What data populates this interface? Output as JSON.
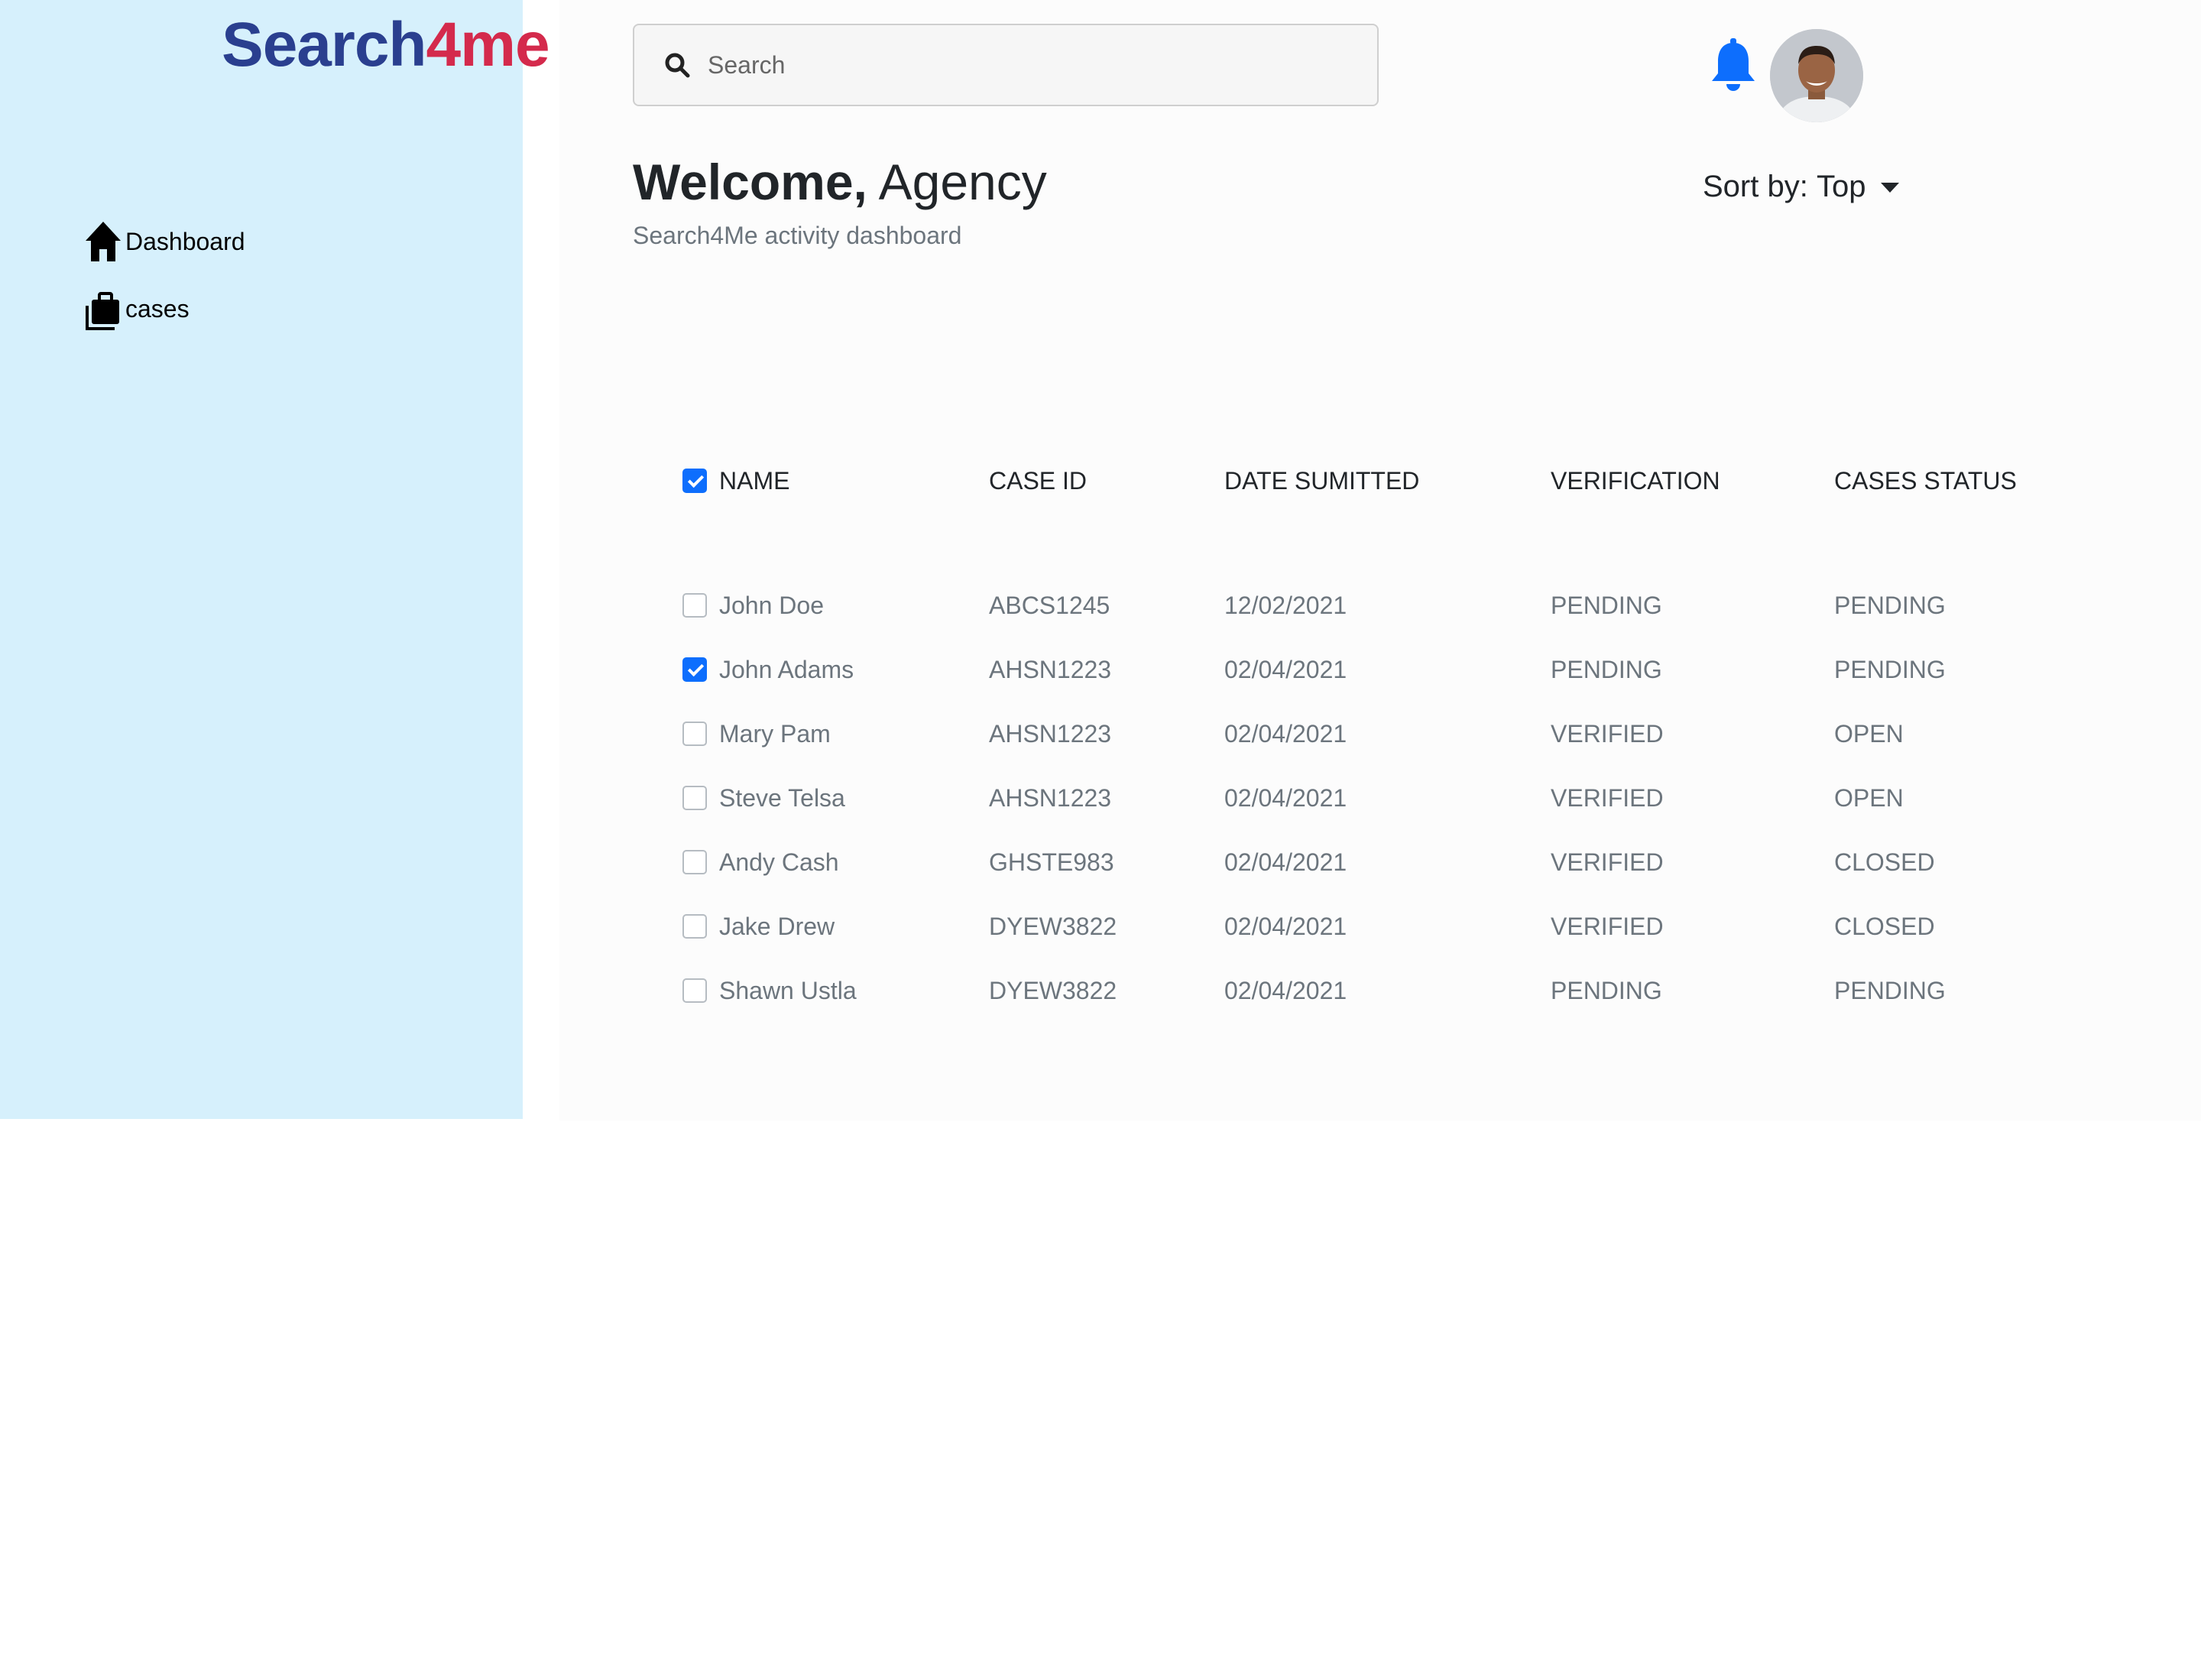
{
  "brand": {
    "part1": "Search",
    "part2": "4me",
    "color_blue": "#2a3f8f",
    "color_red": "#d42a4c"
  },
  "sidebar": {
    "background": "#d6f0fc",
    "items": [
      {
        "label": "Dashboard",
        "icon": "home-icon"
      },
      {
        "label": "cases",
        "icon": "briefcase-icon"
      }
    ]
  },
  "header": {
    "search": {
      "placeholder": "Search",
      "value": ""
    },
    "notification_icon": "bell-icon",
    "accent_color": "#0d6efd"
  },
  "main": {
    "welcome_bold": "Welcome,",
    "welcome_name": "Agency",
    "subtitle": "Search4Me activity dashboard",
    "sort_label": "Sort by:",
    "sort_value": "Top"
  },
  "table": {
    "select_all_checked": true,
    "columns": [
      "NAME",
      "CASE ID",
      "DATE SUMITTED",
      "VERIFICATION",
      "CASES STATUS"
    ],
    "rows": [
      {
        "checked": false,
        "name": "John Doe",
        "case_id": "ABCS1245",
        "date": "12/02/2021",
        "verification": "PENDING",
        "status": "PENDING"
      },
      {
        "checked": true,
        "name": "John Adams",
        "case_id": "AHSN1223",
        "date": "02/04/2021",
        "verification": "PENDING",
        "status": "PENDING"
      },
      {
        "checked": false,
        "name": "Mary Pam",
        "case_id": "AHSN1223",
        "date": "02/04/2021",
        "verification": "VERIFIED",
        "status": "OPEN"
      },
      {
        "checked": false,
        "name": "Steve Telsa",
        "case_id": "AHSN1223",
        "date": "02/04/2021",
        "verification": "VERIFIED",
        "status": "OPEN"
      },
      {
        "checked": false,
        "name": "Andy Cash",
        "case_id": "GHSTE983",
        "date": "02/04/2021",
        "verification": "VERIFIED",
        "status": "CLOSED"
      },
      {
        "checked": false,
        "name": "Jake Drew",
        "case_id": "DYEW3822",
        "date": "02/04/2021",
        "verification": "VERIFIED",
        "status": "CLOSED"
      },
      {
        "checked": false,
        "name": "Shawn Ustla",
        "case_id": "DYEW3822",
        "date": "02/04/2021",
        "verification": "PENDING",
        "status": "PENDING"
      }
    ]
  }
}
